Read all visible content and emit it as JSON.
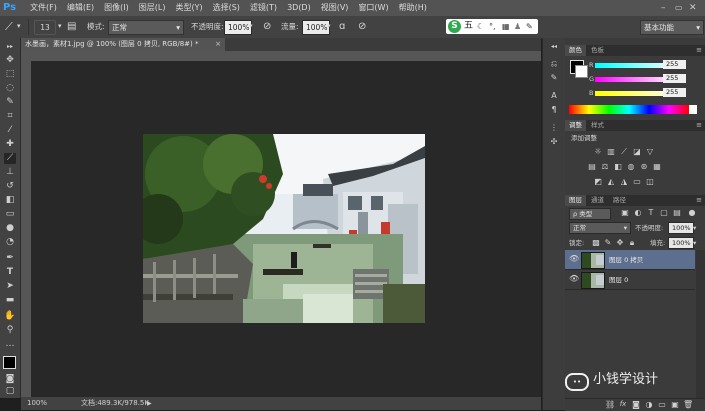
{
  "app": {
    "logo": "Ps"
  },
  "menu": [
    "文件(F)",
    "编辑(E)",
    "图像(I)",
    "图层(L)",
    "类型(Y)",
    "选择(S)",
    "滤镜(T)",
    "3D(D)",
    "视图(V)",
    "窗口(W)",
    "帮助(H)"
  ],
  "options": {
    "brush_size": "13",
    "mode_label": "模式:",
    "mode_value": "正常",
    "opacity_label": "不透明度:",
    "opacity_value": "100%",
    "flow_label": "流量:",
    "flow_value": "100%",
    "ime_label": "五",
    "workspace": "基本功能"
  },
  "document": {
    "tab_title": "水墨画，素材1.jpg @ 100% (图层 0 拷贝, RGB/8#) *",
    "zoom": "100%",
    "doc_info": "文档:489.3K/978.5K"
  },
  "color_panel": {
    "tabs": [
      "颜色",
      "色板"
    ],
    "channels": [
      {
        "label": "R",
        "value": "255"
      },
      {
        "label": "G",
        "value": "255"
      },
      {
        "label": "B",
        "value": "255"
      }
    ]
  },
  "adjust_panel": {
    "tabs": [
      "调整",
      "样式"
    ],
    "title": "添加调整"
  },
  "layers_panel": {
    "tabs": [
      "图层",
      "通道",
      "路径"
    ],
    "filter_label": "ρ 类型",
    "blend_mode": "正常",
    "opacity_label": "不透明度:",
    "opacity_value": "100%",
    "lock_label": "锁定:",
    "fill_label": "填充:",
    "fill_value": "100%",
    "layers": [
      {
        "name": "图层 0 拷贝",
        "selected": true
      },
      {
        "name": "图层 0",
        "selected": false
      }
    ]
  },
  "watermark": {
    "text": "小钱学设计"
  },
  "colors": {
    "accent": "#36a3ff",
    "selected_layer": "#5d6f8f"
  }
}
